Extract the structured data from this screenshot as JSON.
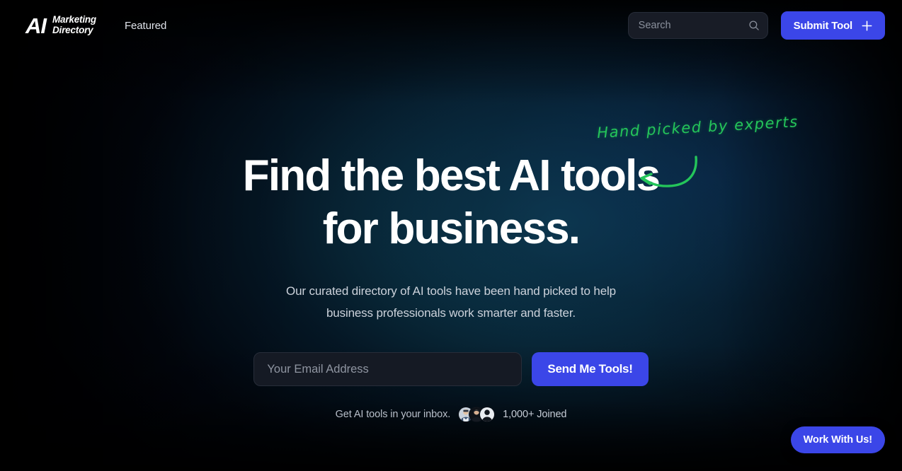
{
  "header": {
    "logo": {
      "mark": "AI",
      "line1": "Marketing",
      "line2": "Directory"
    },
    "nav": [
      {
        "label": "Featured"
      }
    ],
    "search": {
      "placeholder": "Search",
      "value": "",
      "icon": "search-icon"
    },
    "submit_button": {
      "label": "Submit Tool",
      "icon": "plus-icon",
      "color": "#3b46e8"
    }
  },
  "hero": {
    "title_line1": "Find the best AI tools",
    "title_line2": "for business.",
    "subtitle_line1": "Our curated directory of AI tools have been hand picked to",
    "subtitle_line2": "help business professionals work smarter and faster.",
    "annotation": {
      "text": "Hand picked by experts",
      "color": "#24c55a",
      "arrow": "curved-arrow-left-icon"
    },
    "form": {
      "email_placeholder": "Your Email Address",
      "email_value": "",
      "submit_label": "Send Me Tools!",
      "submit_color": "#3b46e8"
    },
    "social_proof": {
      "text": "Get AI tools in your inbox.",
      "count": "1,000+ Joined",
      "avatars": [
        {
          "name": "avatar-1"
        },
        {
          "name": "avatar-2"
        },
        {
          "name": "avatar-3"
        }
      ]
    }
  },
  "floating_cta": {
    "label": "Work With Us!",
    "color": "#3b46e8"
  },
  "theme": {
    "background": "#000005",
    "accent": "#3b46e8",
    "annotation_green": "#24c55a",
    "text_primary": "#ffffff",
    "text_muted": "#ccd2db"
  }
}
